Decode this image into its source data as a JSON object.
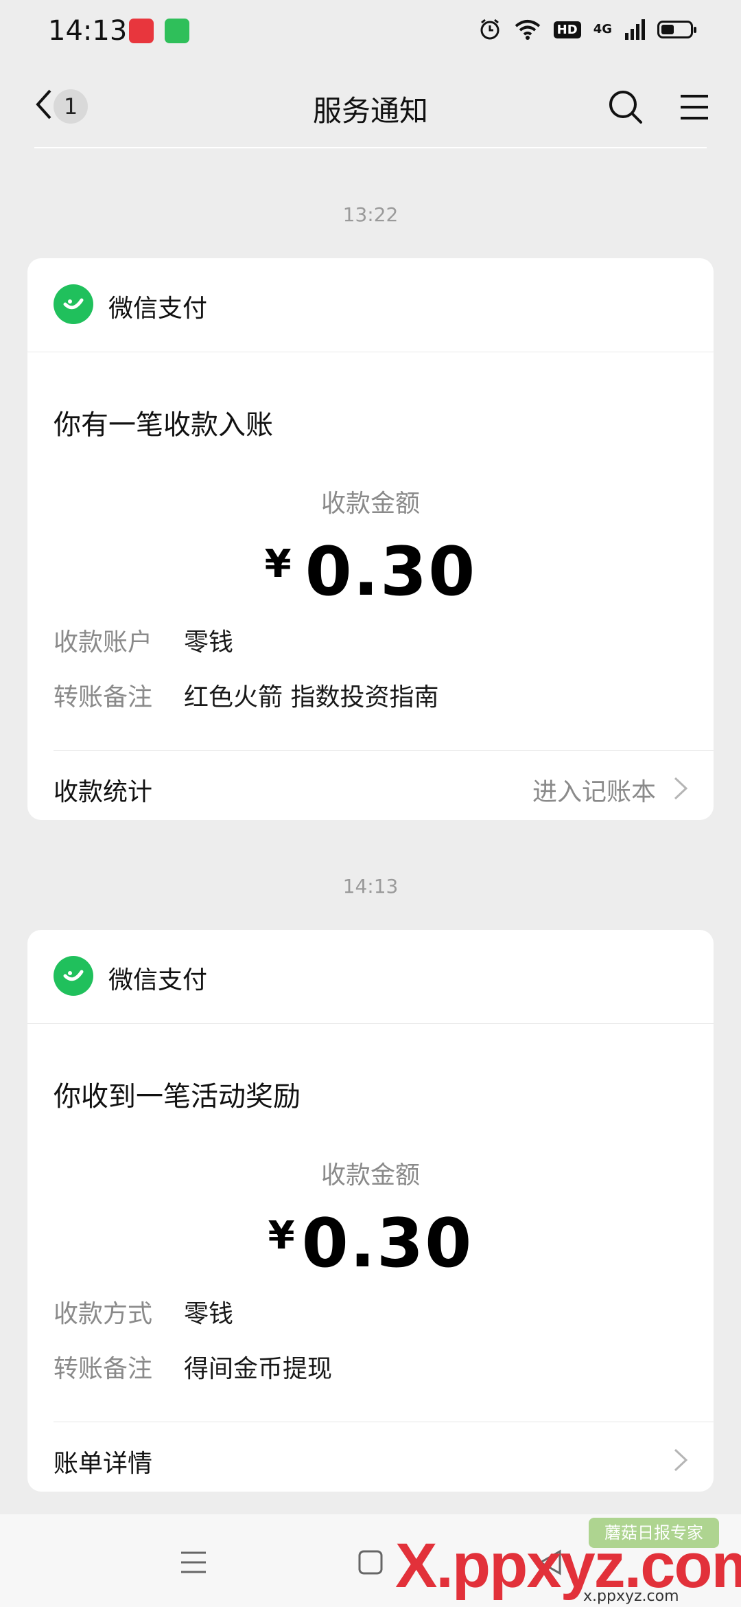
{
  "status_bar": {
    "time": "14:13",
    "network": "4G",
    "hd": "HD"
  },
  "nav": {
    "unread_count": "1",
    "title": "服务通知"
  },
  "messages": [
    {
      "timestamp": "13:22",
      "brand": "微信支付",
      "title": "你有一笔收款入账",
      "amount_label": "收款金额",
      "currency": "¥",
      "amount": "0.30",
      "rows": [
        {
          "label": "收款账户",
          "value": "零钱"
        },
        {
          "label": "转账备注",
          "value": "红色火箭 指数投资指南"
        }
      ],
      "footer_label": "收款统计",
      "footer_link": "进入记账本"
    },
    {
      "timestamp": "14:13",
      "brand": "微信支付",
      "title": "你收到一笔活动奖励",
      "amount_label": "收款金额",
      "currency": "¥",
      "amount": "0.30",
      "rows": [
        {
          "label": "收款方式",
          "value": "零钱"
        },
        {
          "label": "转账备注",
          "value": "得间金币提现"
        }
      ],
      "footer_label": "账单详情",
      "footer_link": ""
    }
  ],
  "watermark": {
    "logo": "X.ppxyz.com",
    "badge": "蘑菇日报专家",
    "sub": "x.ppxyz.com"
  },
  "colors": {
    "background": "#ededed",
    "wechat_pay_green": "#20c05c",
    "watermark_red": "#e2313a"
  },
  "icons": {
    "back": "chevron-left-icon",
    "search": "search-icon",
    "menu": "hamburger-menu-icon",
    "brand": "wechat-pay-icon",
    "chevron": "chevron-right-icon"
  }
}
